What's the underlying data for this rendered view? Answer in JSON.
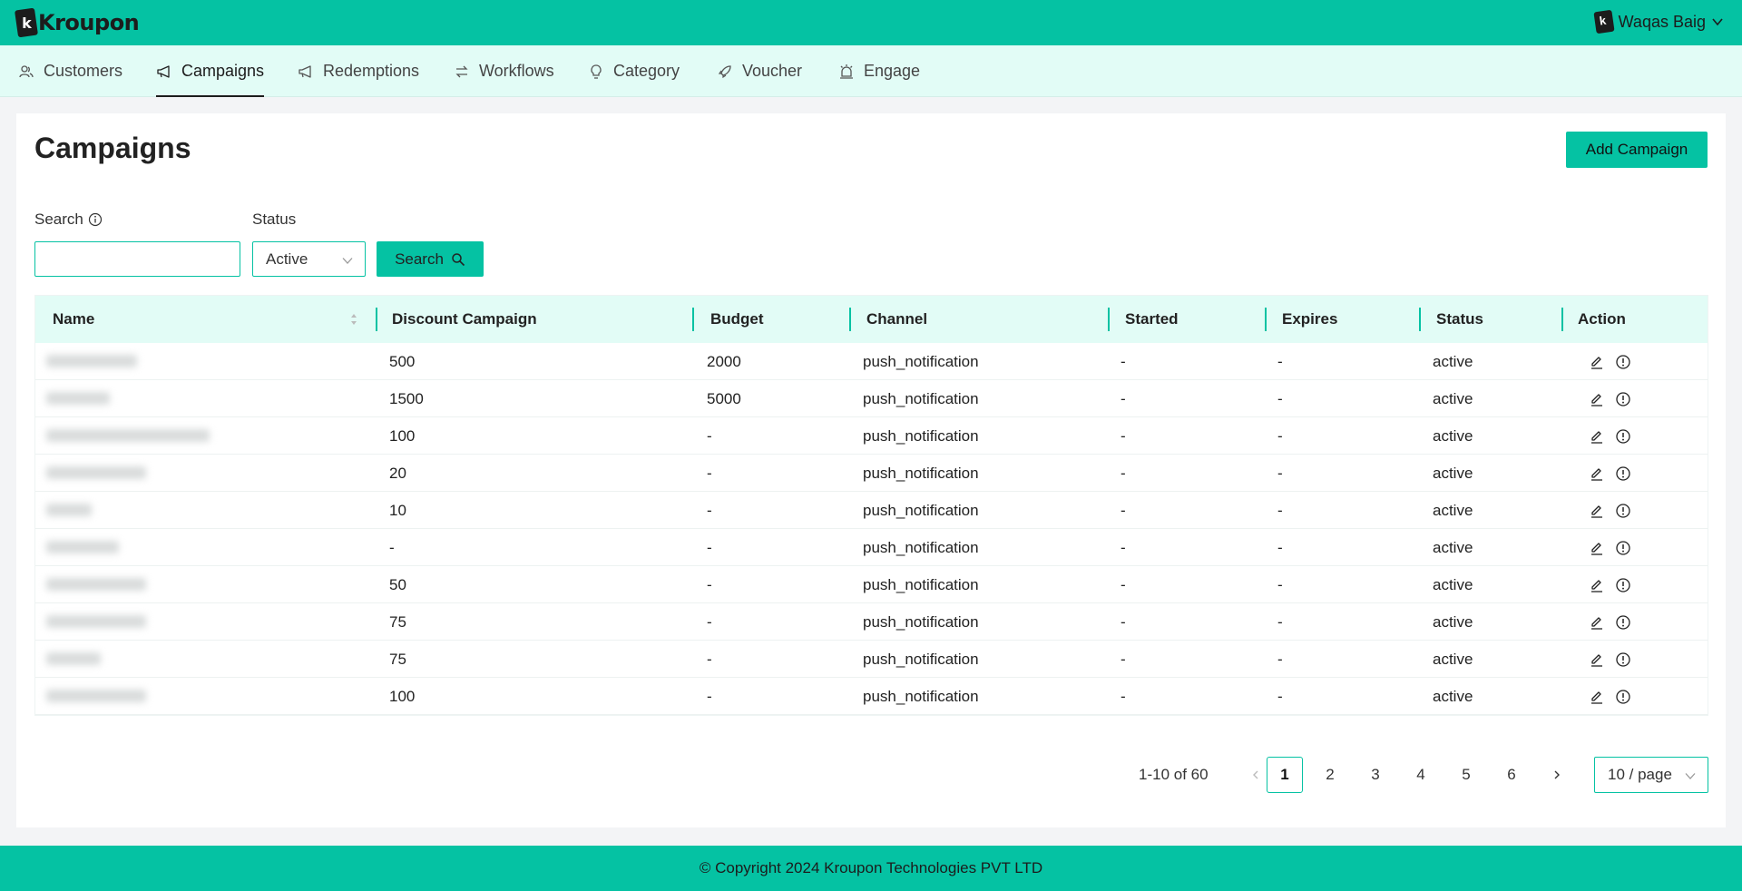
{
  "header": {
    "logo_text": "Kroupon",
    "logo_letter": "k",
    "user_name": "Waqas Baig"
  },
  "nav": {
    "items": [
      {
        "label": "Customers"
      },
      {
        "label": "Campaigns"
      },
      {
        "label": "Redemptions"
      },
      {
        "label": "Workflows"
      },
      {
        "label": "Category"
      },
      {
        "label": "Voucher"
      },
      {
        "label": "Engage"
      }
    ],
    "active": "Campaigns"
  },
  "page": {
    "title": "Campaigns",
    "add_button": "Add Campaign"
  },
  "filters": {
    "search_label": "Search",
    "search_value": "",
    "status_label": "Status",
    "status_value": "Active",
    "search_button": "Search"
  },
  "table": {
    "columns": [
      "Name",
      "Discount Campaign",
      "Budget",
      "Channel",
      "Started",
      "Expires",
      "Status",
      "Action"
    ],
    "rows": [
      {
        "discount": "500",
        "budget": "2000",
        "channel": "push_notification",
        "started": "-",
        "expires": "-",
        "status": "active"
      },
      {
        "discount": "1500",
        "budget": "5000",
        "channel": "push_notification",
        "started": "-",
        "expires": "-",
        "status": "active"
      },
      {
        "discount": "100",
        "budget": "-",
        "channel": "push_notification",
        "started": "-",
        "expires": "-",
        "status": "active"
      },
      {
        "discount": "20",
        "budget": "-",
        "channel": "push_notification",
        "started": "-",
        "expires": "-",
        "status": "active"
      },
      {
        "discount": "10",
        "budget": "-",
        "channel": "push_notification",
        "started": "-",
        "expires": "-",
        "status": "active"
      },
      {
        "discount": "-",
        "budget": "-",
        "channel": "push_notification",
        "started": "-",
        "expires": "-",
        "status": "active"
      },
      {
        "discount": "50",
        "budget": "-",
        "channel": "push_notification",
        "started": "-",
        "expires": "-",
        "status": "active"
      },
      {
        "discount": "75",
        "budget": "-",
        "channel": "push_notification",
        "started": "-",
        "expires": "-",
        "status": "active"
      },
      {
        "discount": "75",
        "budget": "-",
        "channel": "push_notification",
        "started": "-",
        "expires": "-",
        "status": "active"
      },
      {
        "discount": "100",
        "budget": "-",
        "channel": "push_notification",
        "started": "-",
        "expires": "-",
        "status": "active"
      }
    ]
  },
  "pagination": {
    "range_text": "1-10 of 60",
    "pages": [
      "1",
      "2",
      "3",
      "4",
      "5",
      "6"
    ],
    "current": "1",
    "page_size": "10 / page"
  },
  "footer": {
    "copyright": "© Copyright 2024 Kroupon Technologies PVT LTD"
  },
  "colors": {
    "brand": "#05c2a3",
    "nav_bg": "#e2fcf6"
  }
}
